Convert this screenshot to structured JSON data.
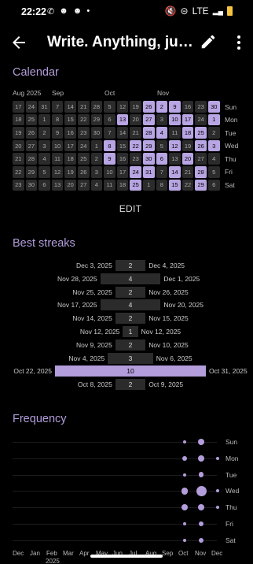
{
  "status_bar": {
    "time": "22:22",
    "left_icons": [
      "whatsapp-icon",
      "snapchat-icon",
      "snapchat-icon",
      "dot-icon"
    ],
    "right_icons": [
      "mute-icon",
      "dnd-icon"
    ],
    "network": "LTE",
    "battery_color": "#f5c542"
  },
  "appbar": {
    "title": "Write. Anything, just one line a day."
  },
  "calendar": {
    "title": "Calendar",
    "months": [
      "Aug 2025",
      "Sep",
      "Oct",
      "Nov"
    ],
    "weekdays": [
      "Sun",
      "Mon",
      "Tue",
      "Wed",
      "Thu",
      "Fri",
      "Sat"
    ],
    "edit_label": "EDIT",
    "accent": "#b8a5e3",
    "columns": [
      [
        [
          17,
          0
        ],
        [
          18,
          0
        ],
        [
          19,
          0
        ],
        [
          20,
          0
        ],
        [
          21,
          0
        ],
        [
          22,
          0
        ],
        [
          23,
          0
        ]
      ],
      [
        [
          24,
          0
        ],
        [
          25,
          0
        ],
        [
          26,
          0
        ],
        [
          27,
          0
        ],
        [
          28,
          0
        ],
        [
          29,
          0
        ],
        [
          30,
          0
        ]
      ],
      [
        [
          31,
          0
        ],
        [
          1,
          0
        ],
        [
          2,
          0
        ],
        [
          3,
          0
        ],
        [
          4,
          0
        ],
        [
          5,
          0
        ],
        [
          6,
          0
        ]
      ],
      [
        [
          7,
          0
        ],
        [
          8,
          0
        ],
        [
          9,
          0
        ],
        [
          10,
          0
        ],
        [
          11,
          0
        ],
        [
          12,
          0
        ],
        [
          13,
          0
        ]
      ],
      [
        [
          14,
          0
        ],
        [
          15,
          0
        ],
        [
          16,
          0
        ],
        [
          17,
          0
        ],
        [
          18,
          0
        ],
        [
          19,
          0
        ],
        [
          20,
          0
        ]
      ],
      [
        [
          21,
          0
        ],
        [
          22,
          0
        ],
        [
          23,
          0
        ],
        [
          24,
          0
        ],
        [
          25,
          0
        ],
        [
          26,
          0
        ],
        [
          27,
          0
        ]
      ],
      [
        [
          28,
          0
        ],
        [
          29,
          0
        ],
        [
          30,
          0
        ],
        [
          1,
          0
        ],
        [
          2,
          0
        ],
        [
          3,
          0
        ],
        [
          4,
          0
        ]
      ],
      [
        [
          5,
          0
        ],
        [
          6,
          0
        ],
        [
          7,
          0
        ],
        [
          8,
          1
        ],
        [
          9,
          1
        ],
        [
          10,
          0
        ],
        [
          11,
          0
        ]
      ],
      [
        [
          12,
          0
        ],
        [
          13,
          1
        ],
        [
          14,
          0
        ],
        [
          15,
          0
        ],
        [
          16,
          0
        ],
        [
          17,
          0
        ],
        [
          18,
          0
        ]
      ],
      [
        [
          19,
          0
        ],
        [
          20,
          0
        ],
        [
          21,
          0
        ],
        [
          22,
          1
        ],
        [
          23,
          0
        ],
        [
          24,
          1
        ],
        [
          25,
          1
        ]
      ],
      [
        [
          26,
          1
        ],
        [
          27,
          1
        ],
        [
          28,
          1
        ],
        [
          29,
          1
        ],
        [
          30,
          1
        ],
        [
          31,
          1
        ],
        [
          1,
          0
        ]
      ],
      [
        [
          2,
          1
        ],
        [
          3,
          0
        ],
        [
          4,
          1
        ],
        [
          5,
          0
        ],
        [
          6,
          1
        ],
        [
          7,
          0
        ],
        [
          8,
          0
        ]
      ],
      [
        [
          9,
          1
        ],
        [
          10,
          1
        ],
        [
          11,
          0
        ],
        [
          12,
          1
        ],
        [
          13,
          0
        ],
        [
          14,
          1
        ],
        [
          15,
          1
        ]
      ],
      [
        [
          16,
          0
        ],
        [
          17,
          1
        ],
        [
          18,
          1
        ],
        [
          19,
          0
        ],
        [
          20,
          1
        ],
        [
          21,
          0
        ],
        [
          22,
          0
        ]
      ],
      [
        [
          23,
          0
        ],
        [
          24,
          0
        ],
        [
          25,
          1
        ],
        [
          26,
          1
        ],
        [
          27,
          0
        ],
        [
          28,
          1
        ],
        [
          29,
          1
        ]
      ],
      [
        [
          30,
          1
        ],
        [
          1,
          1
        ],
        [
          2,
          0
        ],
        [
          3,
          1
        ],
        [
          4,
          0
        ],
        [
          5,
          0
        ],
        [
          6,
          0
        ]
      ]
    ]
  },
  "streaks": {
    "title": "Best streaks",
    "items": [
      {
        "start": "Dec 3, 2025",
        "end": "Dec 4, 2025",
        "length": 2
      },
      {
        "start": "Nov 28, 2025",
        "end": "Dec 1, 2025",
        "length": 4
      },
      {
        "start": "Nov 25, 2025",
        "end": "Nov 26, 2025",
        "length": 2
      },
      {
        "start": "Nov 17, 2025",
        "end": "Nov 20, 2025",
        "length": 4
      },
      {
        "start": "Nov 14, 2025",
        "end": "Nov 15, 2025",
        "length": 2
      },
      {
        "start": "Nov 12, 2025",
        "end": "Nov 12, 2025",
        "length": 1
      },
      {
        "start": "Nov 9, 2025",
        "end": "Nov 10, 2025",
        "length": 2
      },
      {
        "start": "Nov 4, 2025",
        "end": "Nov 6, 2025",
        "length": 3
      },
      {
        "start": "Oct 22, 2025",
        "end": "Oct 31, 2025",
        "length": 10
      },
      {
        "start": "Oct 8, 2025",
        "end": "Oct 9, 2025",
        "length": 2
      }
    ]
  },
  "frequency": {
    "title": "Frequency",
    "weekdays": [
      "Sun",
      "Mon",
      "Tue",
      "Wed",
      "Thu",
      "Fri",
      "Sat"
    ],
    "months": [
      "Dec",
      "Jan",
      "Feb",
      "Mar",
      "Apr",
      "May",
      "Jun",
      "Jul",
      "Aug",
      "Sep",
      "Oct",
      "Nov",
      "Dec"
    ],
    "year": "2025",
    "dots": [
      {
        "day": "Sun",
        "month": "Oct",
        "count": 1
      },
      {
        "day": "Sun",
        "month": "Nov",
        "count": 3
      },
      {
        "day": "Mon",
        "month": "Oct",
        "count": 2
      },
      {
        "day": "Mon",
        "month": "Nov",
        "count": 3
      },
      {
        "day": "Mon",
        "month": "Dec",
        "count": 1
      },
      {
        "day": "Tue",
        "month": "Oct",
        "count": 1
      },
      {
        "day": "Tue",
        "month": "Nov",
        "count": 2
      },
      {
        "day": "Wed",
        "month": "Oct",
        "count": 3
      },
      {
        "day": "Wed",
        "month": "Nov",
        "count": 5
      },
      {
        "day": "Wed",
        "month": "Dec",
        "count": 1
      },
      {
        "day": "Thu",
        "month": "Oct",
        "count": 3
      },
      {
        "day": "Thu",
        "month": "Nov",
        "count": 3
      },
      {
        "day": "Thu",
        "month": "Dec",
        "count": 1
      },
      {
        "day": "Fri",
        "month": "Oct",
        "count": 1
      },
      {
        "day": "Fri",
        "month": "Nov",
        "count": 2
      },
      {
        "day": "Sat",
        "month": "Oct",
        "count": 1
      },
      {
        "day": "Sat",
        "month": "Nov",
        "count": 2
      }
    ]
  }
}
